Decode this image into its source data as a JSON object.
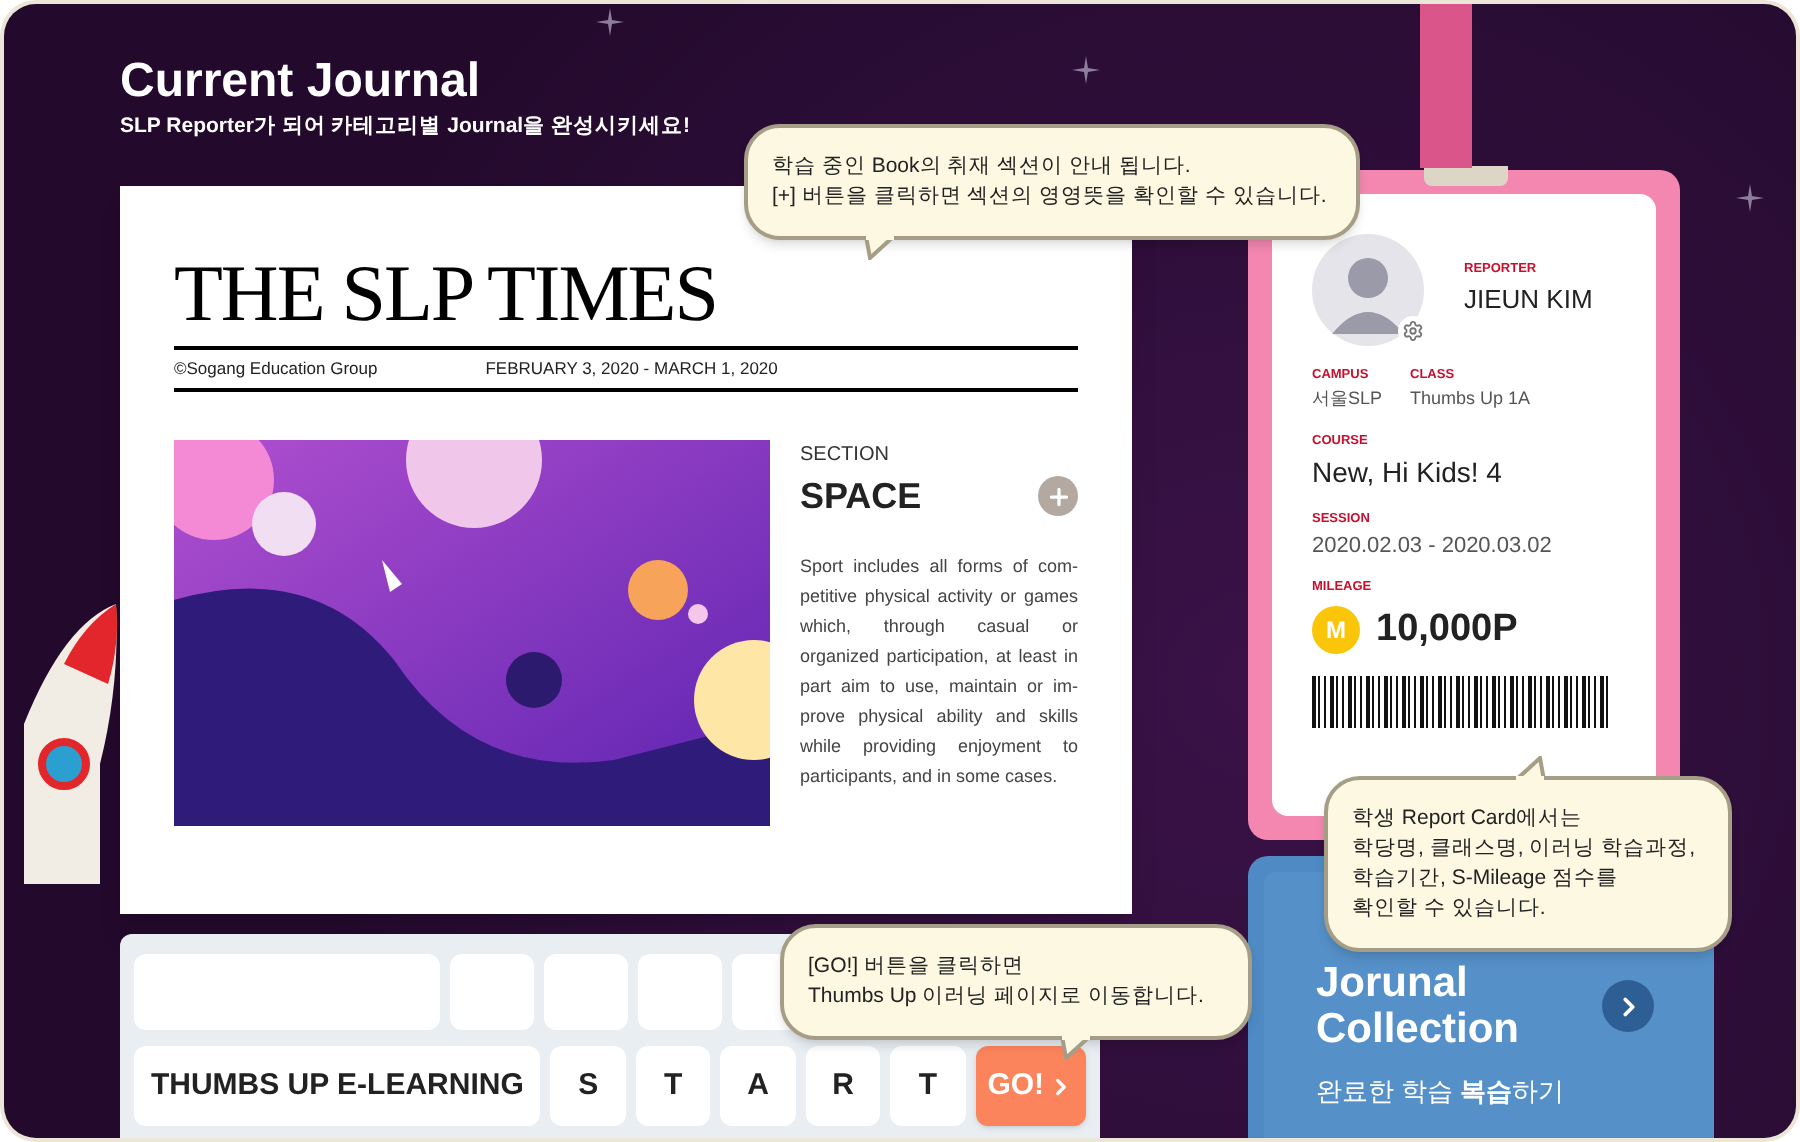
{
  "header": {
    "title": "Current Journal",
    "subtitle": "SLP Reporter가 되어 카테고리별 Journal을 완성시키세요!"
  },
  "newspaper": {
    "masthead": "THE SLP TIMES",
    "publisher": "©Sogang Education Group",
    "dates": "FEBRUARY 3, 2020 - MARCH 1, 2020",
    "section_label": "SECTION",
    "section_title": "SPACE",
    "body": "Sport includes all forms of com-petitive physical activity or games which, through casual or organized participation, at least in part aim to use, maintain or im-prove physical ability and skills while providing enjoyment to participants, and in some cases."
  },
  "keyboard": {
    "blank_keys": [
      {
        "kind": "wide"
      },
      {
        "kind": "small"
      },
      {
        "kind": "small"
      },
      {
        "kind": "small"
      },
      {
        "kind": "small"
      }
    ],
    "label": "THUMBS UP E-LEARNING",
    "letters": [
      "S",
      "T",
      "A",
      "R",
      "T"
    ],
    "go": "GO!"
  },
  "report_card": {
    "reporter_label": "REPORTER",
    "name": "JIEUN KIM",
    "fields": [
      {
        "label": "CAMPUS",
        "value": "서울SLP"
      },
      {
        "label": "CLASS",
        "value": "Thumbs Up 1A"
      }
    ],
    "course_label": "COURSE",
    "course": "New, Hi Kids! 4",
    "session_label": "SESSION",
    "session": "2020.02.03 - 2020.03.02",
    "mileage_label": "MILEAGE",
    "mileage_badge": "M",
    "mileage": "10,000P"
  },
  "collection": {
    "title": "Jorunal Collection",
    "subtitle": "완료한 학습 **복습**하기"
  },
  "tooltips": [
    {
      "kind": "book",
      "lines": [
        "학습 중인 Book의 취재 섹션이 안내 됩니다.",
        "[+] 버튼을 클릭하면 섹션의 영영뜻을 확인할 수 있습니다."
      ]
    },
    {
      "kind": "card",
      "lines": [
        "학생 Report Card에서는",
        "학당명, 클래스명, 이러닝 학습과정,",
        "학습기간, S-Mileage 점수를",
        "확인할 수 있습니다."
      ]
    },
    {
      "kind": "go",
      "lines": [
        "[GO!] 버튼을 클릭하면",
        "Thumbs Up 이러닝 페이지로 이동합니다."
      ]
    }
  ]
}
